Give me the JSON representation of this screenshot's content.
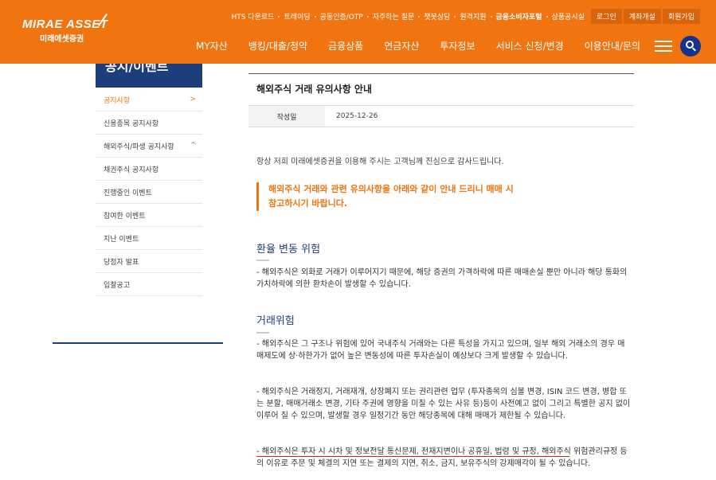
{
  "header": {
    "logo_en": "MIRAE ASSET",
    "logo_ko": "미래에셋증권",
    "util_links": [
      "HTS 다운로드",
      "트레이딩",
      "공동인증/OTP",
      "자주하는 질문",
      "챗봇상담",
      "원격지원",
      "금융소비자포털",
      "상품공시실"
    ],
    "login_label": "로그인",
    "open_account_label": "계좌개설",
    "join_label": "회원가입",
    "gnb": [
      "MY자산",
      "뱅킹/대출/청약",
      "금융상품",
      "연금자산",
      "투자정보",
      "서비스 신청/변경",
      "이용안내/문의"
    ],
    "menu_icon": "hamburger-icon",
    "search_icon": "search-icon",
    "brand_color": "#f07511",
    "navy_color": "#1e3d7d"
  },
  "sidebar": {
    "title": "공지/이벤트",
    "items": [
      {
        "label": "공지사항",
        "active": true
      },
      {
        "label": "신용종목 공지사항"
      },
      {
        "label": "해외주식/파생 공지사항"
      },
      {
        "label": "채권주식 공지사항"
      },
      {
        "label": "진행중인 이벤트"
      },
      {
        "label": "참여한 이벤트"
      },
      {
        "label": "지난 이벤트"
      },
      {
        "label": "당첨자 발표"
      },
      {
        "label": "입찰공고"
      }
    ]
  },
  "post": {
    "title": "해외주식 거래 유의사항 안내",
    "date_label": "작성일",
    "date_value": "2025-12-26",
    "intro": "항상 저희 미래에셋증권을 이용해 주시는 고객님께 진심으로 감사드립니다.",
    "notice_line1": "해외주식 거래와 관련 유의사항을 아래와 같이 안내 드리니 매매 시",
    "notice_line2": "참고하시기 바랍니다.",
    "section1_title": "환율 변동 위험",
    "section1_text": "- 해외주식은 외화로 거래가 이루어지기 때문에, 해당 증권의 가격하락에 따른 매매손실 뿐만 아니라 해당 통화의 가치하락에 의한 환차손이 발생할 수 있습니다.",
    "section2_title": "거래위험",
    "section2_p1": "- 해외주식은 그 구조나 위험에 있어 국내주식 거래와는 다른 특성을 가지고 있으며, 일부 해외 거래소의 경우 매매제도에 상·하한가가 없어 높은 변동성에 따른 투자손실이 예상보다 크게 발생할 수 있습니다.",
    "section2_p2": "- 해외주식은 거래정지, 거래재개, 상장폐지 또는 권리관련 업무 (투자종목의 심볼 변경, ISIN 코드 변경, 병합 또는 분할, 매매거래소 변경, 기타 주권에 영향을 미칠 수 있는 사유 등)등이 사전예고 없이 그리고 특별한 공지 없이 이루어 질 수 있으며, 발생할 경우 일정기간 동안 해당종목에 대해 매매가 제한될 수 있습니다.",
    "section2_p3": "- 해외주식은 투자 시 시차 및 정보전달 통신문제, 천재지변이나 공휴일, 법령 및 규정, 해외주식 위험관리규정 등의 이유로 주문 및 체결의 지연 또는 결제의 지연, 취소, 금지, 보유주식의 강제매각이 될 수 있습니다."
  }
}
